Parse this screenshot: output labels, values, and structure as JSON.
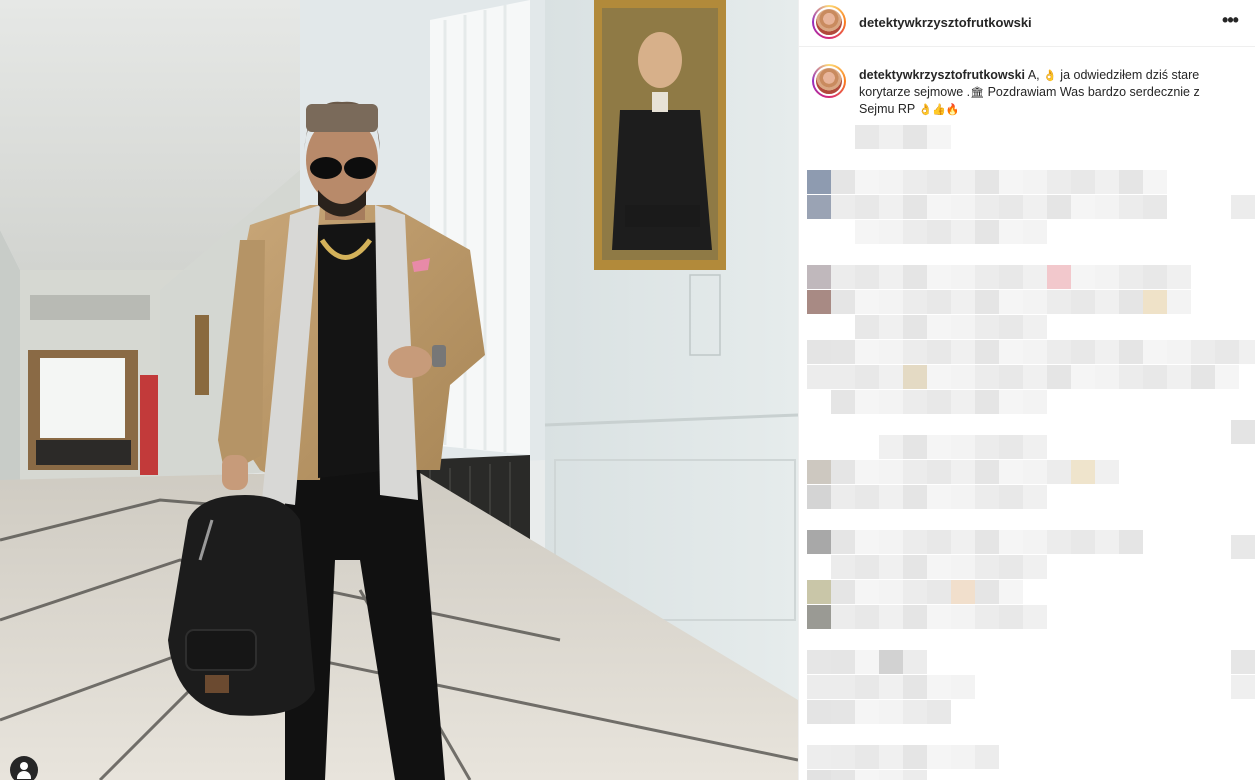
{
  "post": {
    "username": "detektywkrzysztofrutkowski",
    "more_icon": "more-horizontal-icon",
    "caption": {
      "user": "detektywkrzysztofrutkowski",
      "text_1": "A, ",
      "emoji_1": "👌",
      "text_2": " ja odwiedziłem dziś stare korytarze sejmowe .",
      "emoji_2": "🏛",
      "text_3": " Pozdrawiam Was bardzo serdecznie z Sejmu RP ",
      "emoji_3": "👌👍🔥"
    }
  },
  "photo": {
    "tag_icon": "user-tag-icon"
  },
  "colors": {
    "text": "#262626",
    "border": "#efefef",
    "pixel_light": "#f0f0f0",
    "pixel_mid": "#e6e6e6"
  }
}
